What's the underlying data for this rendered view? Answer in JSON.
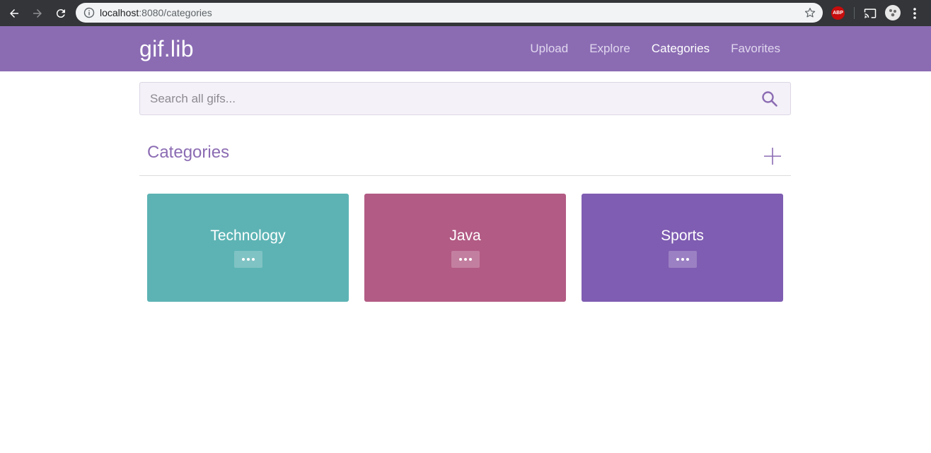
{
  "browser": {
    "url_host": "localhost",
    "url_rest": ":8080/categories",
    "extension_label": "ABP"
  },
  "header": {
    "logo": "gif.lib",
    "nav": [
      {
        "label": "Upload",
        "active": false
      },
      {
        "label": "Explore",
        "active": false
      },
      {
        "label": "Categories",
        "active": true
      },
      {
        "label": "Favorites",
        "active": false
      }
    ]
  },
  "search": {
    "placeholder": "Search all gifs...",
    "value": ""
  },
  "section": {
    "title": "Categories"
  },
  "categories": [
    {
      "name": "Technology",
      "color": "#5db3b4"
    },
    {
      "name": "Java",
      "color": "#b25b84"
    },
    {
      "name": "Sports",
      "color": "#7f5db2"
    }
  ],
  "colors": {
    "brand": "#8b6cb3",
    "header_bg": "#8b6cb3",
    "search_bg": "#f4f1f8"
  }
}
